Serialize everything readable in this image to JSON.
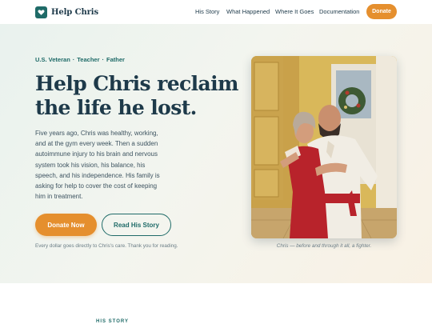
{
  "brand": {
    "name": "Help Chris",
    "icon": "heart-icon",
    "color": "#1f6b68"
  },
  "nav": {
    "links": [
      "His Story",
      "What Happened",
      "Where It Goes",
      "Documentation"
    ],
    "donate_label": "Donate"
  },
  "hero": {
    "eyebrow": [
      "U.S. Veteran",
      "Teacher",
      "Father"
    ],
    "eyebrow_separator": "·",
    "headline_lines": [
      "Help Chris reclaim",
      "the life he lost."
    ],
    "body_lines": [
      "Five years ago, Chris was healthy, working,",
      "and at the gym every week. Then a sudden",
      "autoimmune injury to his brain and nervous",
      "system took his vision, his balance, his",
      "speech, and his independence. His family is",
      "asking for help to cover the cost of keeping",
      "him in treatment."
    ],
    "primary_button": "Donate Now",
    "secondary_button": "Read His Story",
    "note": "Every dollar goes directly to Chris's care. Thank you for reading.",
    "photo_caption": "Chris — before and through it all, a fighter."
  },
  "next_section": {
    "label": "HIS STORY"
  },
  "colors": {
    "accent": "#e58f2e",
    "teal": "#1f6b68",
    "ink": "#1e3a4a"
  }
}
